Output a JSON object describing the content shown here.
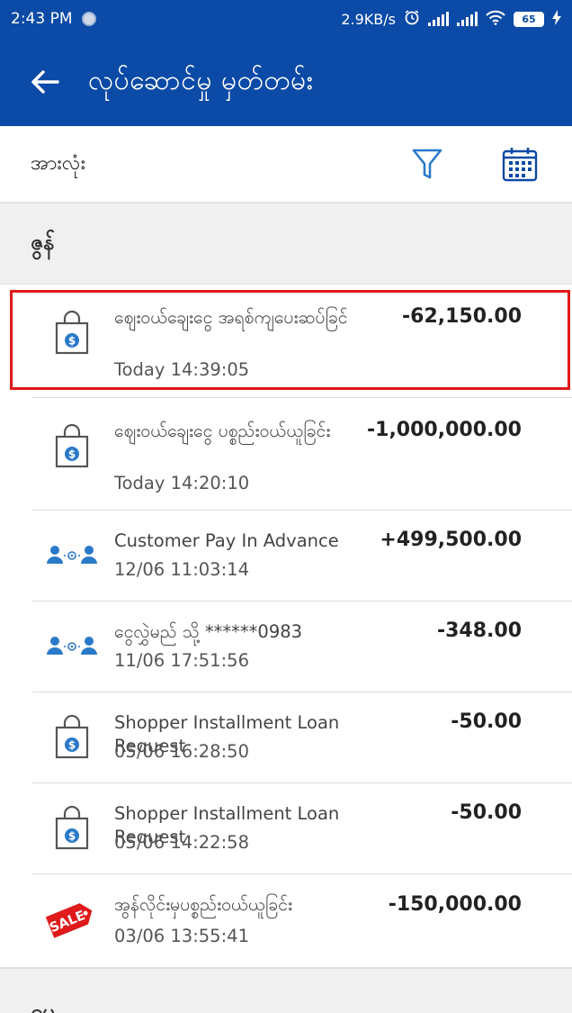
{
  "status_bar": {
    "time": "2:43 PM",
    "net_speed": "2.9KB/s",
    "battery": "65"
  },
  "app_bar": {
    "title": "လုပ်ဆောင်မှု မှတ်တမ်း"
  },
  "filter": {
    "label": "အားလုံး"
  },
  "sections": [
    {
      "header": "ဇွန်",
      "transactions": [
        {
          "icon": "shopping-bag-icon",
          "description": "ဈေးဝယ်ချေးငွေ အရစ်ကျပေးဆပ်ခြင်",
          "time": "Today 14:39:05",
          "amount": "-62,150.00"
        },
        {
          "icon": "shopping-bag-icon",
          "description": "ဈေးဝယ်ချေးငွေ ပစ္စည်းဝယ်ယူခြင်း",
          "time": "Today 14:20:10",
          "amount": "-1,000,000.00"
        },
        {
          "icon": "transfer-people-icon",
          "description": "Customer Pay In Advance",
          "time": "12/06 11:03:14",
          "amount": "+499,500.00"
        },
        {
          "icon": "transfer-people-icon",
          "description": "ငွေလွှဲမည် သို့ ******0983",
          "time": "11/06 17:51:56",
          "amount": "-348.00"
        },
        {
          "icon": "shopping-bag-icon",
          "description": "Shopper Installment Loan Request",
          "time": "05/06 16:28:50",
          "amount": "-50.00"
        },
        {
          "icon": "shopping-bag-icon",
          "description": "Shopper Installment Loan Request",
          "time": "05/06 14:22:58",
          "amount": "-50.00"
        },
        {
          "icon": "sale-tag-icon",
          "description": "အွန်လိုင်းမှပစ္စည်းဝယ်ယူခြင်း",
          "time": "03/06 13:55:41",
          "amount": "-150,000.00",
          "badge": "SALE"
        }
      ]
    },
    {
      "header": "မေ"
    }
  ],
  "colors": {
    "primary": "#0b4aa6",
    "highlight": "#e0191a",
    "icon_blue": "#2a79c9"
  }
}
